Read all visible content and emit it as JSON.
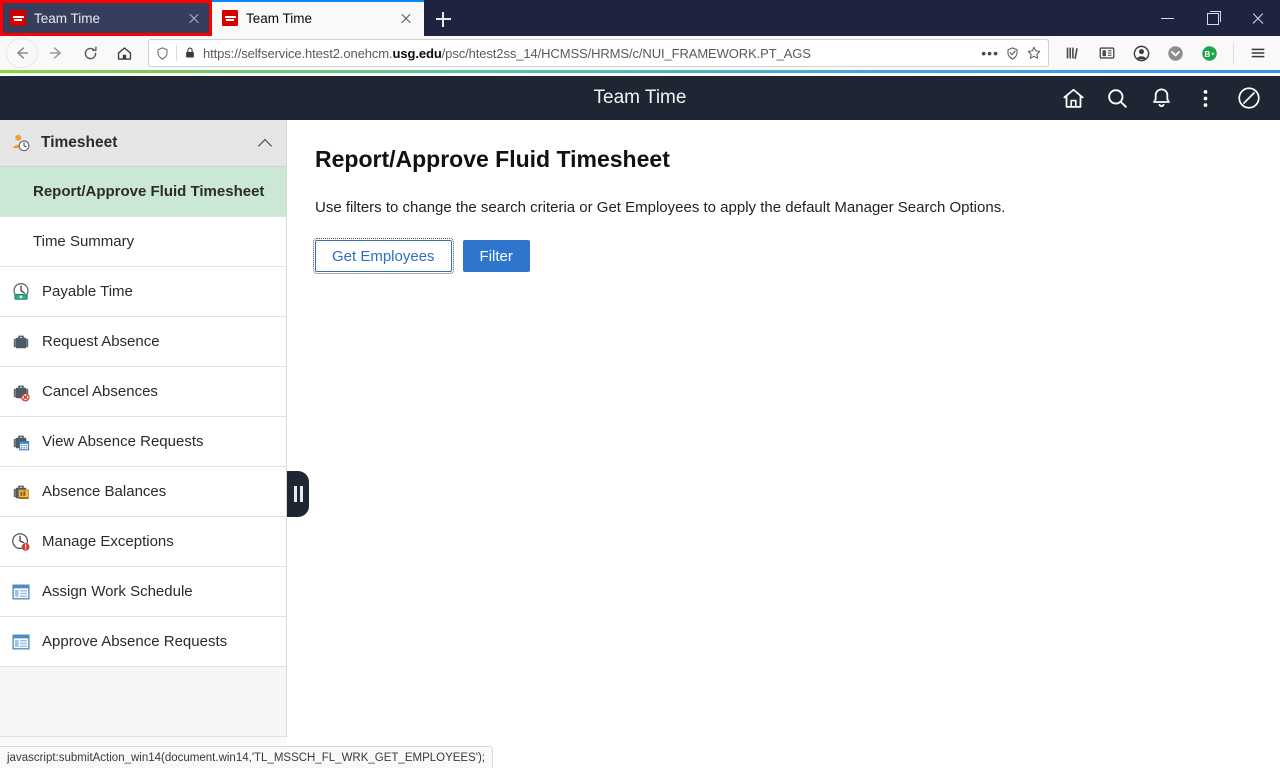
{
  "window": {
    "controls": {
      "minimize": "Minimize",
      "maximize": "Restore",
      "close": "Close"
    }
  },
  "tabs": [
    {
      "title": "Team Time",
      "favicon": "oracle-favicon",
      "active": false,
      "highlighted": true
    },
    {
      "title": "Team Time",
      "favicon": "oracle-favicon",
      "active": true,
      "highlighted": false
    }
  ],
  "newtab_label": "New Tab",
  "toolbar": {
    "back": "Back",
    "forward": "Forward",
    "reload": "Reload",
    "home": "Home",
    "url_prefix": "https://selfservice.htest2.onehcm.",
    "url_domain": "usg.edu",
    "url_suffix": "/psc/htest2ss_14/HCMSS/HRMS/c/NUI_FRAMEWORK.PT_AGS",
    "page_actions": "•••",
    "right_icons": [
      "library-icon",
      "sidebar-icon",
      "account-icon",
      "pocket-icon",
      "bitwarden-icon",
      "app-menu-icon"
    ]
  },
  "app": {
    "title": "Team Time",
    "header_icons": [
      "home-icon",
      "search-icon",
      "notifications-icon",
      "actions-menu-icon",
      "navbar-icon"
    ]
  },
  "sidebar": {
    "header": {
      "label": "Timesheet",
      "icon": "person-clock-icon",
      "expanded": true
    },
    "items": [
      {
        "label": "Report/Approve Fluid Timesheet",
        "icon": "",
        "active": true,
        "sub": true
      },
      {
        "label": "Time Summary",
        "icon": "",
        "active": false,
        "sub": true
      },
      {
        "label": "Payable Time",
        "icon": "payable-time-icon",
        "active": false,
        "sub": false
      },
      {
        "label": "Request Absence",
        "icon": "briefcase-icon",
        "active": false,
        "sub": false
      },
      {
        "label": "Cancel Absences",
        "icon": "briefcase-cancel-icon",
        "active": false,
        "sub": false
      },
      {
        "label": "View Absence Requests",
        "icon": "briefcase-calendar-icon",
        "active": false,
        "sub": false
      },
      {
        "label": "Absence Balances",
        "icon": "briefcase-balance-icon",
        "active": false,
        "sub": false
      },
      {
        "label": "Manage Exceptions",
        "icon": "clock-alert-icon",
        "active": false,
        "sub": false
      },
      {
        "label": "Assign Work Schedule",
        "icon": "window-icon",
        "active": false,
        "sub": false
      },
      {
        "label": "Approve Absence Requests",
        "icon": "window-icon",
        "active": false,
        "sub": false
      }
    ],
    "collapse_handle": "collapse-sidebar-handle"
  },
  "main": {
    "page_title": "Report/Approve Fluid Timesheet",
    "description": "Use filters to change the search criteria or Get Employees to apply the default Manager Search Options.",
    "buttons": [
      {
        "label": "Get Employees",
        "style": "outline"
      },
      {
        "label": "Filter",
        "style": "primary"
      }
    ]
  },
  "statusbar": {
    "text": "javascript:submitAction_win14(document.win14,'TL_MSSCH_FL_WRK_GET_EMPLOYEES');"
  },
  "colors": {
    "chrome_dark": "#20233f",
    "app_header": "#1e2633",
    "active_nav": "#cbe8d6",
    "primary_button": "#2e75cc",
    "link_blue": "#2e6fc7",
    "favicon_red": "#d40000"
  }
}
